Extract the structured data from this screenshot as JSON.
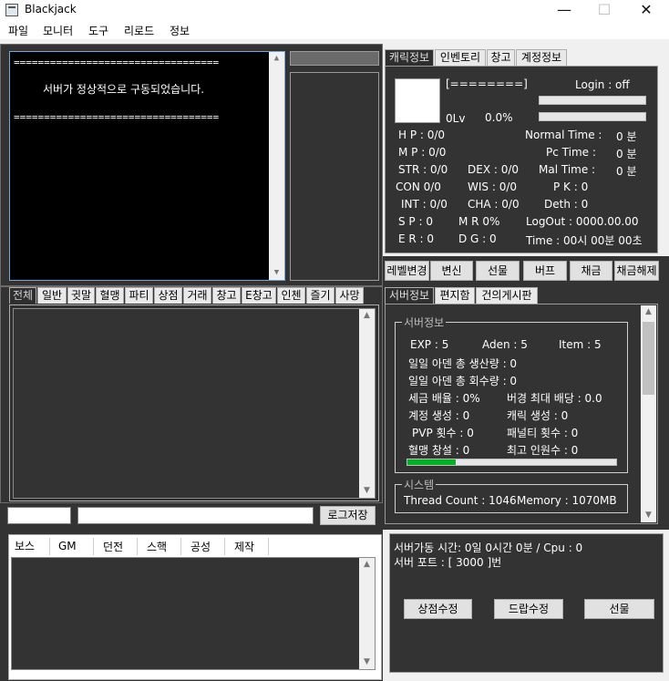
{
  "window": {
    "title": "Blackjack",
    "minimize": "—",
    "maximize": "☐",
    "close": "✕"
  },
  "menu": [
    "파일",
    "모니터",
    "도구",
    "리로드",
    "정보"
  ],
  "console": {
    "line1": "==================================",
    "line2": "서버가 정상적으로 구동되었습니다.",
    "line3": "=================================="
  },
  "chat_tabs": [
    "전체",
    "일반",
    "귓말",
    "혈맹",
    "파티",
    "상점",
    "거래",
    "창고",
    "E창고",
    "인첸",
    "즐기",
    "사망"
  ],
  "log_save_button": "로그저장",
  "bottom_tabs": [
    "보스",
    "GM",
    "던전",
    "스핵",
    "공성",
    "제작"
  ],
  "char_tabs": [
    "캐릭정보",
    "인벤토리",
    "창고",
    "계정정보"
  ],
  "char": {
    "name_bar": "[========]",
    "login": "Login : off",
    "level": "0Lv",
    "exp_pct": "0.0%",
    "hp": "H P :  0/0",
    "mp": "M P :  0/0",
    "normal_time_label": "Normal Time :",
    "normal_time": "0  분",
    "pc_time_label": "Pc Time :",
    "pc_time": "0  분",
    "mal_time_label": "Mal Time :",
    "mal_time": "0  분",
    "str": "STR : 0/0",
    "dex": "DEX : 0/0",
    "con": "CON  0/0",
    "wis": "WIS : 0/0",
    "pk": "P K : 0",
    "int": "INT : 0/0",
    "cha": "CHA : 0/0",
    "deth": "Deth :  0",
    "sp": "S P :  0",
    "mr": "M R   0%",
    "logout": "LogOut :  0000.00.00",
    "er": "E R :  0",
    "dg": "D G : 0",
    "time": "Time :  00시 00분 00초"
  },
  "char_buttons": [
    "레벨변경",
    "변신",
    "선물",
    "버프",
    "채금",
    "채금해제"
  ],
  "server_tabs": [
    "서버정보",
    "편지함",
    "건의게시판"
  ],
  "server": {
    "group_title": "서버정보",
    "exp": "EXP : 5",
    "aden": "Aden : 5",
    "item": "Item : 5",
    "daily_aden_produced": "일일 아덴 총 생산량 :   0",
    "daily_aden_recovered": "일일 아덴 총 회수량 :   0",
    "tax_rate": "세금 배율 :  0%",
    "max_dividend": "버경 최대 배당 : 0.0",
    "accounts_created": "계정 생성 :   0",
    "chars_created": "캐릭 생성 :  0",
    "pvp_count": "PVP 횟수 :  0",
    "penalty_count": "패널티 횟수 :   0",
    "clans_created": "혈맹 창설 :   0",
    "max_users": "최고 인원수 :   0",
    "progress": 0.23,
    "system_title": "시스템",
    "thread_count": "Thread Count : 1046",
    "memory": "Memory : 1070MB"
  },
  "status": {
    "uptime": "서버가동 시간:  0일 0시간 0분 / Cpu : 0",
    "port": "서버 포트 :  [ 3000 ]번",
    "shop_edit": "상점수정",
    "drop_edit": "드랍수정",
    "gift": "선물"
  },
  "colors": {
    "panel_bg": "#333333",
    "console_bg": "#000000",
    "progress_fill": "#06b025"
  }
}
